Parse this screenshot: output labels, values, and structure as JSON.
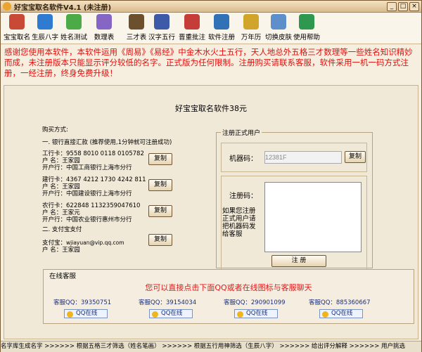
{
  "title": "好宝宝取名软件V4.1 (未注册)",
  "toolbar": [
    {
      "label": "宝宝取名",
      "icon": "name-pen-icon",
      "color": "#c84a36"
    },
    {
      "label": "生辰八字",
      "icon": "globe-icon",
      "color": "#2f7bd1"
    },
    {
      "label": "姓名测试",
      "icon": "people-icon",
      "color": "#4cab47"
    },
    {
      "label": "数理表",
      "icon": "number-table-icon",
      "color": "#8666c5"
    },
    {
      "label": "三才表",
      "icon": "book-icon",
      "color": "#6c4f2d"
    },
    {
      "label": "汉字五行",
      "icon": "brush-icon",
      "color": "#3d5aa9"
    },
    {
      "label": "晋重批注",
      "icon": "scissors-pencil-icon",
      "color": "#c43d38"
    },
    {
      "label": "软件注册",
      "icon": "register-icon",
      "color": "#3171b6"
    },
    {
      "label": "万年历",
      "icon": "calendar-icon",
      "color": "#d1a52a"
    },
    {
      "label": "切换皮肤",
      "icon": "skin-icon",
      "color": "#5f8fcb"
    },
    {
      "label": "使用帮助",
      "icon": "help-icon",
      "color": "#2e9850"
    }
  ],
  "notice": "感谢您使用本软件，本软件运用《周易》《易经》中金木水火土五行，天人地总外五格三才数理等一些姓名知识精妙而成，未注册版本只能显示评分较低的名字。正式版为任何限制。注册购买请联系客服，软件采用一机一码方式注册，一经注册，终身免费升级！",
  "main": {
    "price_title": "好宝宝取名软件38元",
    "buy_label": "购买方式:",
    "bank_section": "一. 银行直接汇款 (推荐使用,1分钟就可注册成功)",
    "banks": [
      {
        "card_label": "工行卡：",
        "card_no": "9558 8010 0118 0105782",
        "holder_label": "户  名：",
        "holder": "王家园",
        "branch_label": "开户行：",
        "branch": "中国工商银行上海市分行"
      },
      {
        "card_label": "建行卡：",
        "card_no": "4367 4212 1730 4242 811",
        "holder_label": "户  名：",
        "holder": "王家园",
        "branch_label": "开户行：",
        "branch": "中国建设银行上海市分行"
      },
      {
        "card_label": "农行卡：",
        "card_no": "622848 1132359047610",
        "holder_label": "户  名：",
        "holder": "王家元",
        "branch_label": "开户行：",
        "branch": "中国农业银行惠州市分行"
      }
    ],
    "alipay_section": "二. 支付宝支付",
    "alipay_label": "支付宝：",
    "alipay_account": "wjiayuan@vip.qq.com",
    "alipay_holder_label": "户  名：",
    "alipay_holder": "王家园",
    "copy": "复制",
    "register": {
      "group": "注册正式用户",
      "machine_label": "机器码：",
      "machine_code": "12381F",
      "copy": "复制",
      "code_label": "注册码：",
      "hint": "如果您注册正式用户请把机器码发给客服",
      "submit": "注  册"
    }
  },
  "online": {
    "group": "在线客服",
    "slogan": "您可以直接点击下面QQ或者在线图标与客服聊天",
    "agents": [
      {
        "label": "客服QQ：",
        "qq": "39350751",
        "btn": "QQ在线"
      },
      {
        "label": "客服QQ：",
        "qq": "39154034",
        "btn": "QQ在线"
      },
      {
        "label": "客服QQ：",
        "qq": "290901099",
        "btn": "QQ在线"
      },
      {
        "label": "客服QQ：",
        "qq": "885360667",
        "btn": "QQ在线"
      }
    ]
  },
  "status": "名字库生成名字 >>>>>> 根据五格三才筛选（姓名笔画） >>>>>> 根据五行用神筛选（生辰八字） >>>>>> 给出评分解释 >>>>>> 用户挑选"
}
